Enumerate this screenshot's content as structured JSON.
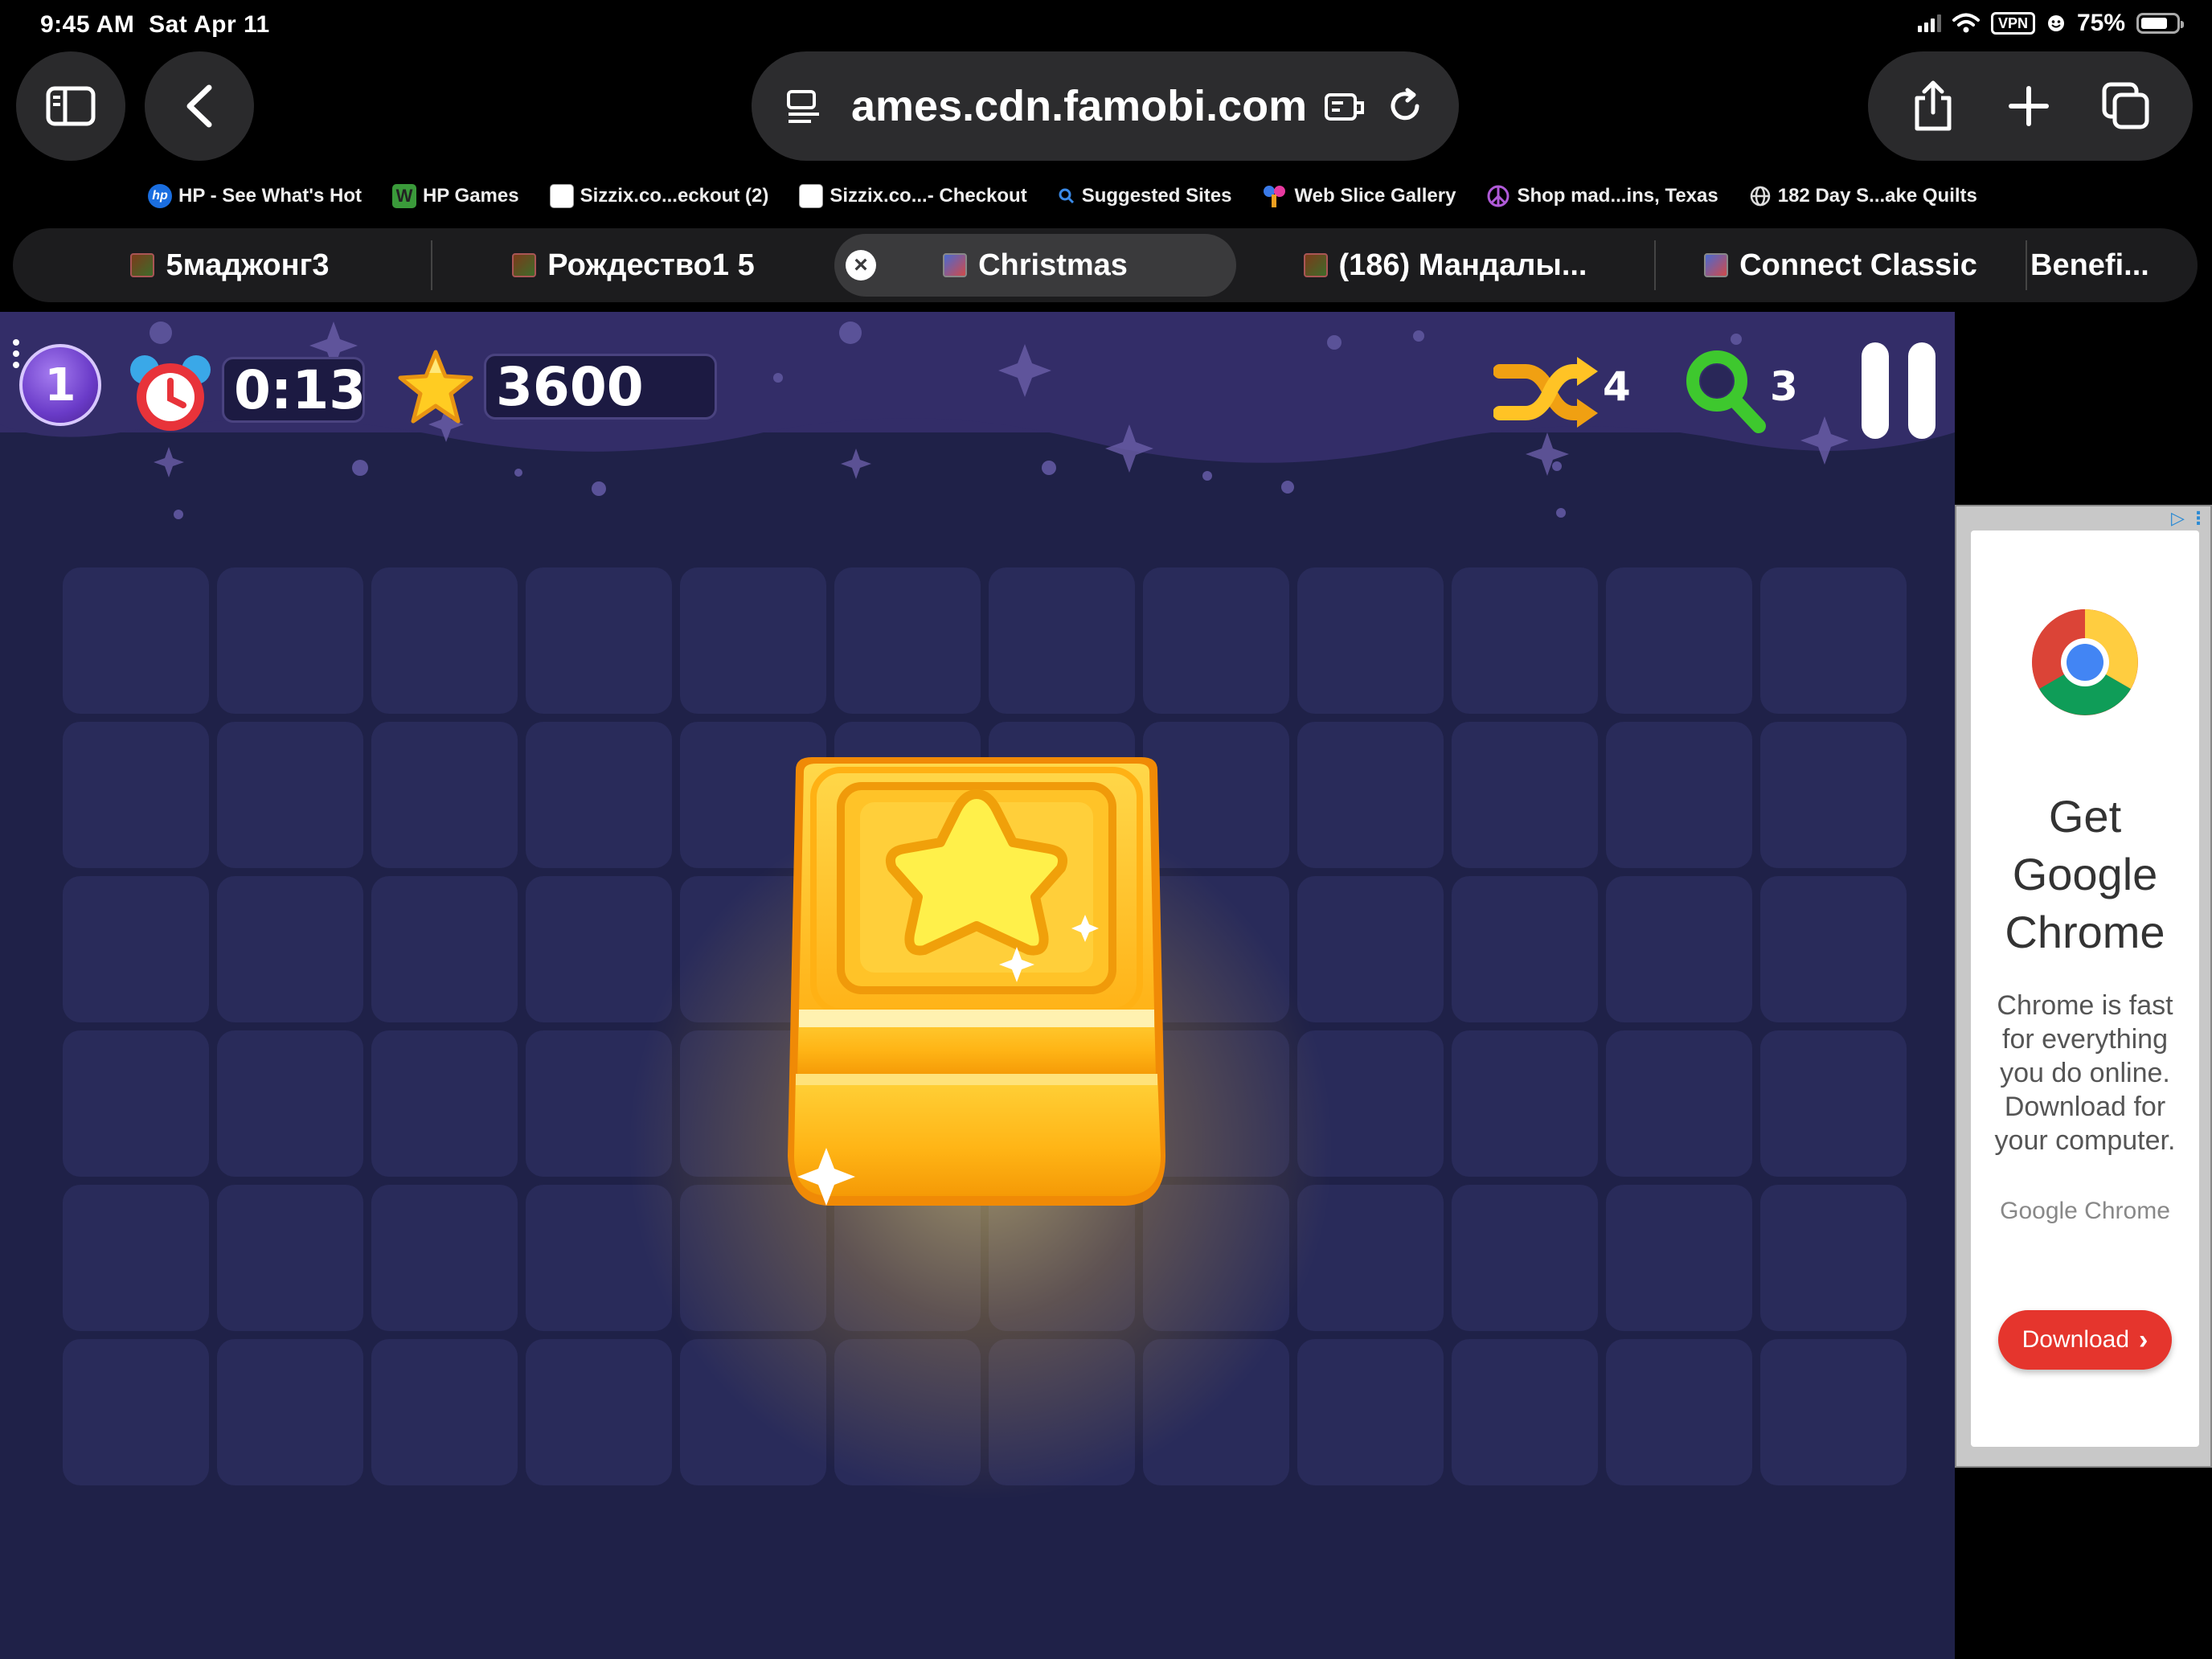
{
  "status_bar": {
    "time": "9:45 AM",
    "date": "Sat Apr 11",
    "vpn_label": "VPN",
    "battery": "75%",
    "battery_level": 0.75
  },
  "toolbar": {
    "url": "ames.cdn.famobi.com",
    "icons": [
      "sidebar-icon",
      "back-icon",
      "page-menu-icon",
      "reader-icon",
      "reload-icon",
      "share-icon",
      "plus-icon",
      "tabs-icon"
    ]
  },
  "favorites": [
    {
      "label": "HP - See What's Hot",
      "icon": "hp-icon"
    },
    {
      "label": "HP Games",
      "icon": "hp-games-icon"
    },
    {
      "label": "Sizzix.co...eckout (2)",
      "icon": "sizzix-icon"
    },
    {
      "label": "Sizzix.co...- Checkout",
      "icon": "sizzix-icon"
    },
    {
      "label": "Suggested Sites",
      "icon": "search-icon"
    },
    {
      "label": "Web Slice Gallery",
      "icon": "web-slice-icon"
    },
    {
      "label": "Shop mad...ins, Texas",
      "icon": "peace-icon"
    },
    {
      "label": "182 Day S...ake Quilts",
      "icon": "globe-icon"
    }
  ],
  "tabs": [
    {
      "label": "5маджонг3",
      "active": false
    },
    {
      "label": "Рождество1 5",
      "active": false
    },
    {
      "label": "Christmas",
      "active": true
    },
    {
      "label": "(186) Мандалы...",
      "active": false
    },
    {
      "label": "Connect Classic",
      "active": false
    },
    {
      "label": "Benefi...",
      "active": false
    }
  ],
  "game": {
    "level": "1",
    "timer": "0:13",
    "score": "3600",
    "shuffle_count": "4",
    "hint_count": "3",
    "board": {
      "rows": 6,
      "cols": 12
    },
    "center_tile": "star-tile"
  },
  "ad": {
    "title_lines": [
      "Get",
      "Google",
      "Chrome"
    ],
    "description": "Chrome is fast for everything you do online. Download for your computer.",
    "sponsor": "Google Chrome",
    "button_label": "Download"
  }
}
